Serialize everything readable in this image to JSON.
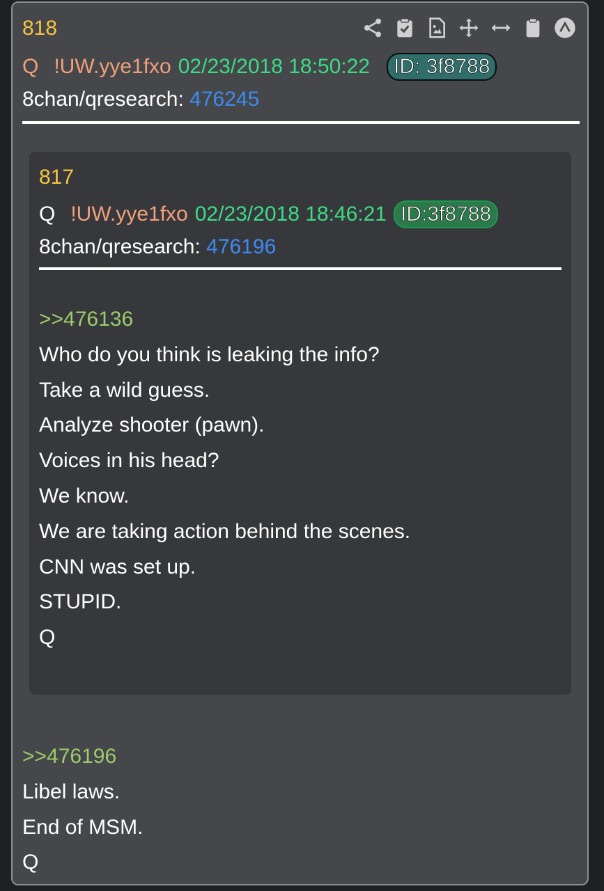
{
  "post": {
    "number": "818",
    "name": "Q",
    "trip": "!UW.yye1fxo",
    "date": "02/23/2018 18:50:22",
    "id": "ID: 3f8788",
    "board": "8chan/qresearch:",
    "post_no": "476245",
    "reply_ref": ">>476196",
    "lines": [
      "Libel laws.",
      "End of MSM.",
      "Q"
    ]
  },
  "quoted": {
    "number": "817",
    "name": "Q",
    "trip": "!UW.yye1fxo",
    "date": "02/23/2018 18:46:21",
    "id": "ID:3f8788",
    "board": "8chan/qresearch:",
    "post_no": "476196",
    "reply_ref": ">>476136",
    "lines": [
      "Who do you think is leaking the info?",
      "Take a wild guess.",
      "Analyze shooter (pawn).",
      "Voices in his head?",
      "We know.",
      "We are taking action behind the scenes.",
      "CNN was set up.",
      "STUPID.",
      "Q"
    ]
  },
  "toolbar": {
    "icons": [
      "share-icon",
      "clipboard-check-icon",
      "image-file-icon",
      "move-icon",
      "expand-horizontal-icon",
      "clipboard-icon",
      "scroll-top-icon"
    ]
  },
  "colors": {
    "card_bg": "#46474b",
    "inner_bg": "#37383c",
    "number": "#f6c542",
    "date": "#3ddc84",
    "link": "#3d8bf2",
    "greentext": "#9ccc6b",
    "name_orange": "#f2a07b"
  }
}
